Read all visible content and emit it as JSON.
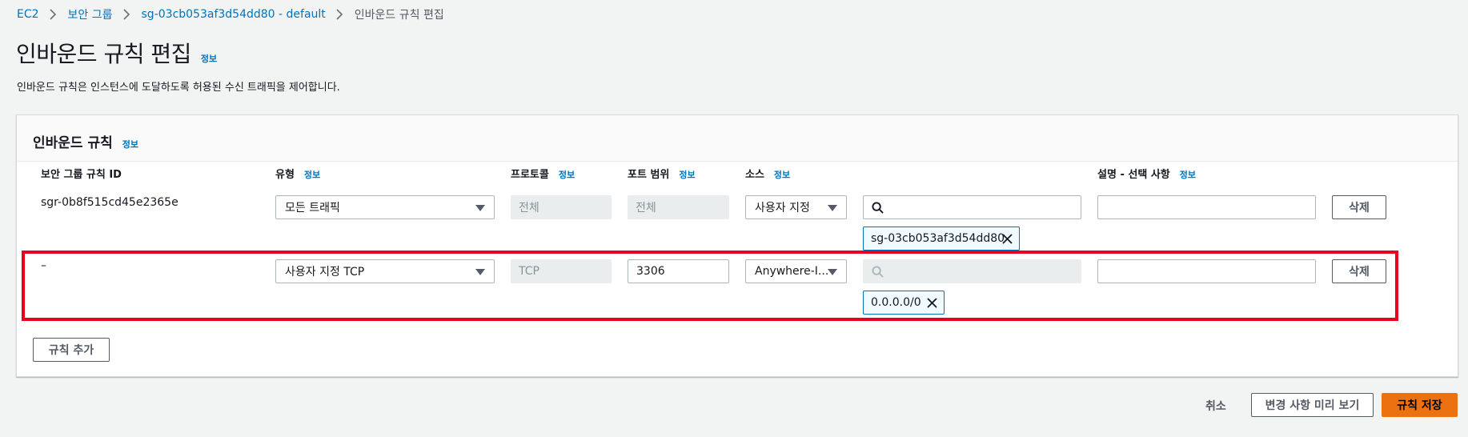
{
  "breadcrumb": {
    "items": [
      "EC2",
      "보안 그룹",
      "sg-03cb053af3d54dd80 - default"
    ],
    "current": "인바운드 규칙 편집"
  },
  "page": {
    "title": "인바운드 규칙 편집",
    "info": "정보",
    "description": "인바운드 규칙은 인스턴스에 도달하도록 허용된 수신 트래픽을 제어합니다."
  },
  "panel": {
    "title": "인바운드 규칙",
    "info": "정보",
    "columns": {
      "rule_id": "보안 그룹 규칙 ID",
      "type": "유형",
      "protocol": "프로토콜",
      "port_range": "포트 범위",
      "source": "소스",
      "description": "설명 - 선택 사항"
    },
    "column_info": "정보"
  },
  "rules": [
    {
      "rule_id": "sgr-0b8f515cd45e2365e",
      "type": "모든 트래픽",
      "protocol": "전체",
      "port_range": "전체",
      "source": "사용자 지정",
      "search_value": "",
      "token": "sg-03cb053af3d54dd80",
      "description": "",
      "delete_label": "삭제"
    },
    {
      "rule_id": "–",
      "type": "사용자 지정 TCP",
      "protocol": "TCP",
      "port_range": "3306",
      "source": "Anywhere-I...",
      "search_value": "",
      "token": "0.0.0.0/0",
      "description": "",
      "delete_label": "삭제"
    }
  ],
  "add_rule_label": "규칙 추가",
  "footer": {
    "cancel": "취소",
    "preview": "변경 사항 미리 보기",
    "save": "규칙 저장"
  },
  "colors": {
    "link": "#0073bb",
    "primary": "#ec7211",
    "highlight": "#e8001f"
  }
}
